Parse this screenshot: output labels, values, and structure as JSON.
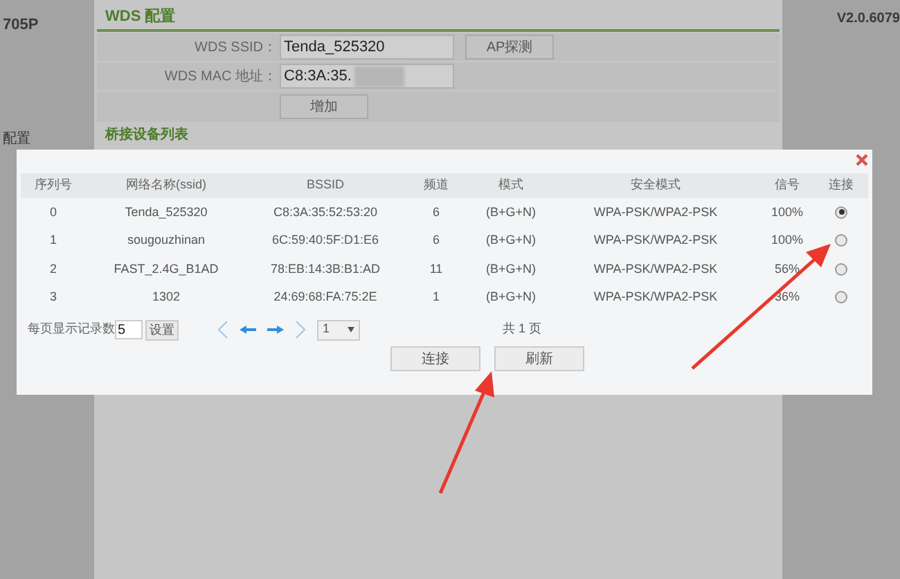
{
  "header": {
    "model": "705P",
    "version": "V2.0.6079"
  },
  "sidebar": {
    "items": [
      {
        "label": "配置"
      }
    ]
  },
  "wds_panel": {
    "title": "WDS 配置",
    "fields": [
      {
        "label": "WDS SSID：",
        "value": "Tenda_525320",
        "button": "AP探测"
      },
      {
        "label": "WDS MAC 地址：",
        "value": "C8:3A:35."
      }
    ],
    "add_button": "增加",
    "bridge_list_title": "桥接设备列表"
  },
  "dialog": {
    "columns": [
      "序列号",
      "网络名称(ssid)",
      "BSSID",
      "频道",
      "模式",
      "安全模式",
      "信号",
      "连接"
    ],
    "rows": [
      {
        "index": "0",
        "ssid": "Tenda_525320",
        "bssid": "C8:3A:35:52:53:20",
        "channel": "6",
        "mode": "(B+G+N)",
        "security": "WPA-PSK/WPA2-PSK",
        "signal": "100%",
        "selected": true
      },
      {
        "index": "1",
        "ssid": "sougouzhinan",
        "bssid": "6C:59:40:5F:D1:E6",
        "channel": "6",
        "mode": "(B+G+N)",
        "security": "WPA-PSK/WPA2-PSK",
        "signal": "100%",
        "selected": false
      },
      {
        "index": "2",
        "ssid": "FAST_2.4G_B1AD",
        "bssid": "78:EB:14:3B:B1:AD",
        "channel": "11",
        "mode": "(B+G+N)",
        "security": "WPA-PSK/WPA2-PSK",
        "signal": "56%",
        "selected": false
      },
      {
        "index": "3",
        "ssid": "1302",
        "bssid": "24:69:68:FA:75:2E",
        "channel": "1",
        "mode": "(B+G+N)",
        "security": "WPA-PSK/WPA2-PSK",
        "signal": "36%",
        "selected": false
      }
    ],
    "pagination": {
      "per_page_label": "每页显示记录数",
      "per_page_value": "5",
      "set_button": "设置",
      "page": "1",
      "total": "共 1 页"
    },
    "buttons": [
      "连接",
      "刷新"
    ]
  }
}
